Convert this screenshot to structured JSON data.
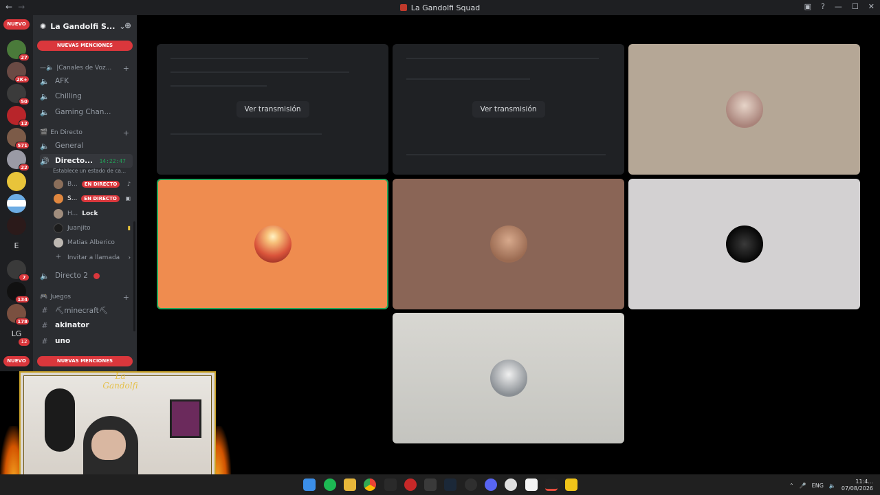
{
  "window": {
    "title": "La Gandolfi Squad",
    "nav_back": "←",
    "nav_forward": "→"
  },
  "server_rail": {
    "new_label_top": "NUEVO",
    "new_label_bottom": "NUEVO",
    "letter_server_1": "E",
    "letter_server_2": "LG",
    "badges": [
      "27",
      "2K+",
      "50",
      "12",
      "571",
      "22",
      "7",
      "134",
      "178",
      "12"
    ]
  },
  "guild": {
    "name": "La Gandolfi S...",
    "new_mentions_top": "NUEVAS MENCIONES",
    "new_mentions_bottom": "NUEVAS MENCIONES"
  },
  "categories": {
    "voice": "|Canales de Voz...",
    "live": "En Directo",
    "games": "Juegos"
  },
  "channels": {
    "afk": "AFK",
    "chilling": "Chilling",
    "gaming": "Gaming Chan...",
    "general": "General",
    "directo1": "Directo...",
    "directo1_time": "14:22:47",
    "directo1_status": "Establece un estado de ca...",
    "directo2": "Directo 2",
    "minecraft": "⛏minecraft⛏",
    "akinator": "akinator",
    "uno": "uno"
  },
  "voice_users": [
    {
      "name": "B...",
      "live": "EN DIRECTO",
      "color": "#8a6e5a"
    },
    {
      "name": "S...",
      "live": "EN DIRECTO",
      "color": "#e0873f"
    },
    {
      "name": "H...",
      "extra": "Lock",
      "color": "#a08d7d"
    },
    {
      "name": "Juanjito",
      "color": "#1c1c1c"
    },
    {
      "name": "Matias Alberico",
      "color": "#bdb8b2"
    }
  ],
  "invite_label": "Invitar a llamada",
  "tiles": {
    "watch_stream_1": "Ver transmisión",
    "watch_stream_2": "Ver transmisión"
  },
  "colors": {
    "orange_tile": "#ef8c4f",
    "brown_tile": "#8a6556",
    "light_tile": "#d3d1d2",
    "beige_tile": "#b5a796",
    "grey_tile": "#cfcfca",
    "live_red": "#da373c",
    "speaking_green": "#23a55a"
  },
  "taskbar": {
    "lang": "ENG",
    "time": "11:4...",
    "date": "07/08/2026"
  },
  "webcam": {
    "overlay_logo": "La Gandolfi"
  }
}
